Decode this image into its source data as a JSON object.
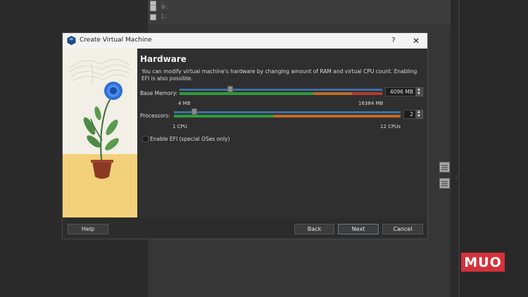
{
  "background": {
    "rows": [
      ":",
      "#:",
      "1:"
    ]
  },
  "logo": {
    "text": "MUO",
    "color": "#d3323b"
  },
  "dialog": {
    "title": "Create Virtual Machine",
    "help_symbol": "?",
    "close_symbol": "✕",
    "heading": "Hardware",
    "description": "You can modify virtual machine's hardware by changing amount of RAM and virtual CPU count. Enabling EFI is also possible.",
    "base_memory": {
      "label": "Base Memory:",
      "value": "4096 MB",
      "min_label": "4 MB",
      "max_label": "16384 MB",
      "fraction": 0.25
    },
    "processors": {
      "label": "Processors:",
      "value": "2",
      "min_label": "1 CPU",
      "max_label": "12 CPUs",
      "fraction": 0.09
    },
    "enable_efi": {
      "label": "Enable EFI (special OSes only)",
      "checked": false
    },
    "buttons": {
      "help": "Help",
      "back": "Back",
      "next": "Next",
      "cancel": "Cancel"
    }
  },
  "colors": {
    "slider_green": "#2e9a3a",
    "slider_orange": "#c06a2a",
    "slider_red": "#b53a2e",
    "slider_blue": "#3d6fa8"
  }
}
